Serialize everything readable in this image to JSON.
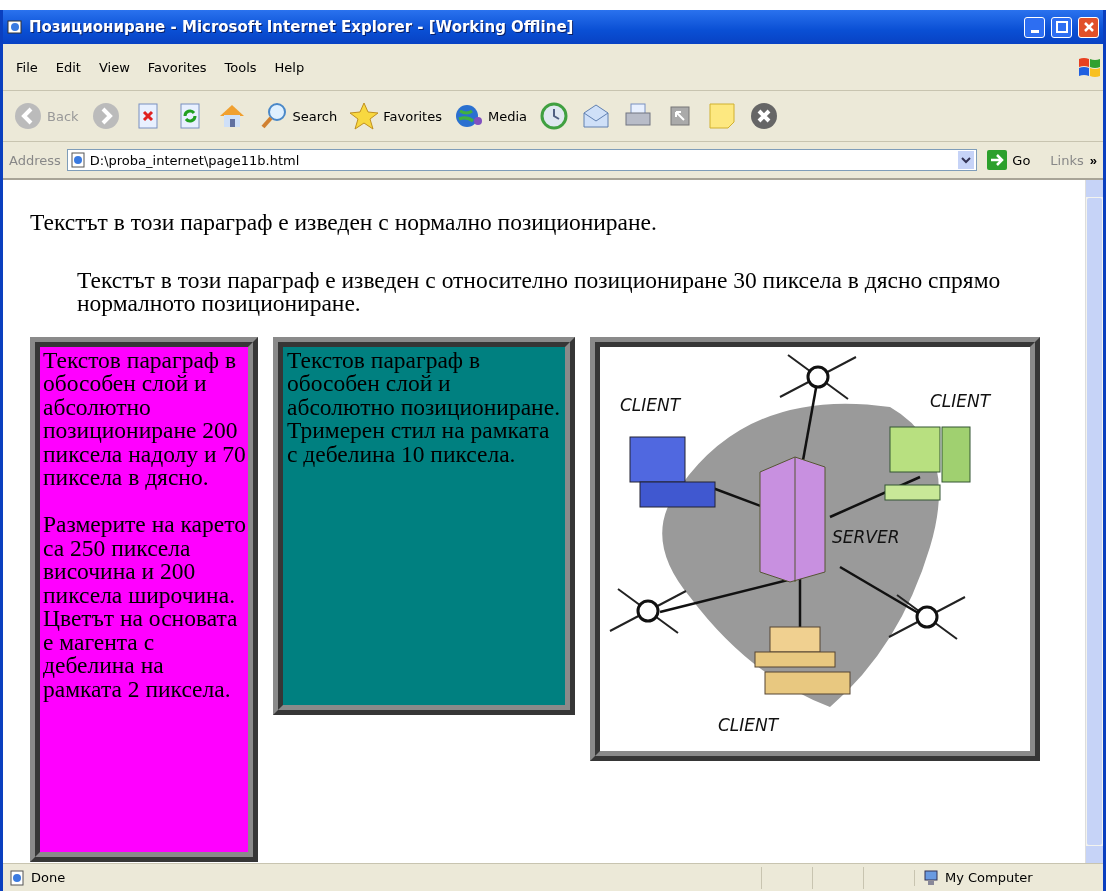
{
  "window": {
    "title": "Позициониране - Microsoft Internet Explorer - [Working Offline]"
  },
  "menu": [
    "File",
    "Edit",
    "View",
    "Favorites",
    "Tools",
    "Help"
  ],
  "toolbar": [
    {
      "kind": "back",
      "label": "Back",
      "disabled": true
    },
    {
      "kind": "forward",
      "disabled": true
    },
    {
      "kind": "stop"
    },
    {
      "kind": "refresh"
    },
    {
      "kind": "home"
    },
    {
      "kind": "search",
      "label": "Search"
    },
    {
      "kind": "favorites",
      "label": "Favorites"
    },
    {
      "kind": "media",
      "label": "Media"
    },
    {
      "kind": "history"
    },
    {
      "kind": "mail"
    },
    {
      "kind": "print"
    },
    {
      "kind": "edit"
    },
    {
      "kind": "note"
    },
    {
      "kind": "close"
    }
  ],
  "address": {
    "label": "Address",
    "value": "D:\\proba_internet\\page11b.html",
    "go": "Go",
    "links": "Links",
    "more": "»"
  },
  "page": {
    "paragraphs": [
      "Текстът в този параграф е изведен с нормално позициониране.",
      "Текстът в този параграф е изведен с относително позициониране 30 пиксела в дясно спрямо нормалното позициониране."
    ],
    "layers": [
      {
        "kind": "text",
        "color": "#ff00ff",
        "paragraphs": [
          "Текстов параграф в обособен слой и абсолютно позициониране 200 пиксела надолу и 70 пиксела в дясно.",
          "Размерите на карето са 250 пиксела височина и 200 пиксела широчина. Цветът на основата е магента с дебелина на рамката 2 пиксела."
        ]
      },
      {
        "kind": "text",
        "color": "#008080",
        "paragraphs": [
          "Текстов параграф в обособен слой и абсолютно позициониране. Тримерен стил на рамката с дебелина 10 пиксела."
        ]
      },
      {
        "kind": "figure",
        "labels": [
          "CLIENT",
          "CLIENT",
          "SERVER",
          "CLIENT"
        ]
      }
    ]
  },
  "status_bar": {
    "text": "Done",
    "zone": "My Computer"
  }
}
